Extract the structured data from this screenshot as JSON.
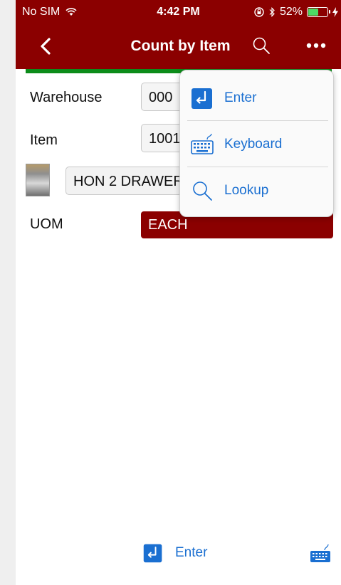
{
  "status_bar": {
    "carrier": "No SIM",
    "time": "4:42 PM",
    "battery": "52%",
    "battery_level": 0.52
  },
  "nav": {
    "title": "Count by Item"
  },
  "form": {
    "warehouse_label": "Warehouse",
    "warehouse_value": "000",
    "item_label": "Item",
    "item_value": "1001",
    "description_value": "HON 2 DRAWER",
    "uom_label": "UOM",
    "uom_value": "EACH"
  },
  "menu": {
    "items": [
      {
        "label": "Enter",
        "icon": "enter-icon"
      },
      {
        "label": "Keyboard",
        "icon": "keyboard-icon"
      },
      {
        "label": "Lookup",
        "icon": "search-icon"
      }
    ]
  },
  "toolbar": {
    "enter_label": "Enter"
  },
  "colors": {
    "header": "#8b0000",
    "accent": "#1a6fd1",
    "progress": "#0c8c1a"
  }
}
